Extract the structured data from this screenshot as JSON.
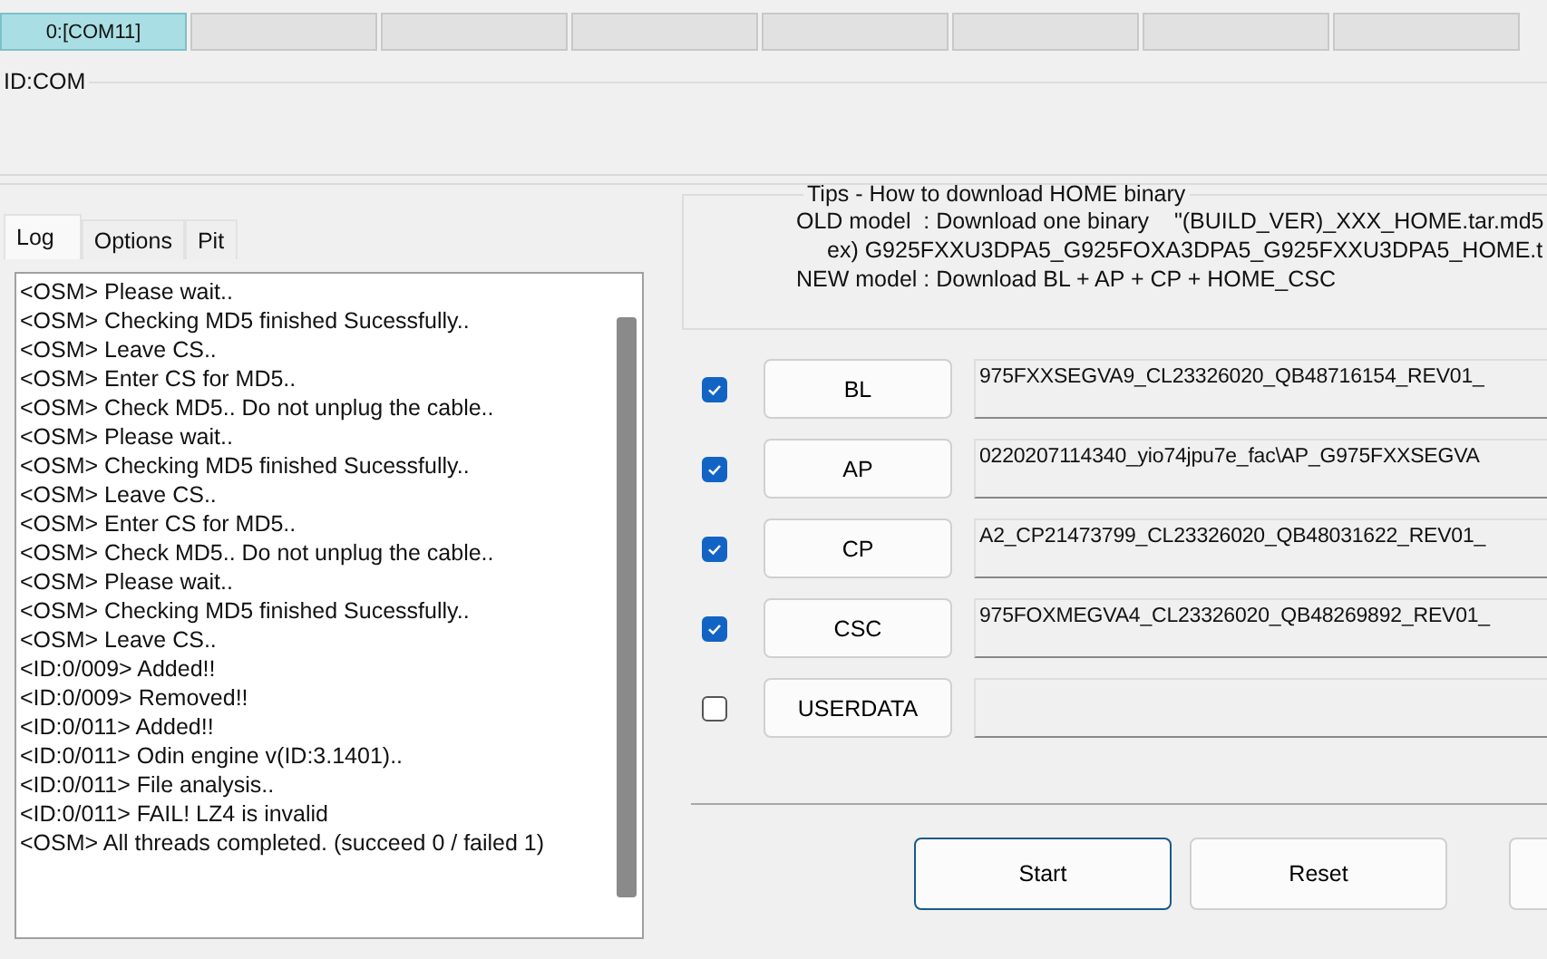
{
  "ports": [
    {
      "label": "0:[COM11]",
      "selected": true
    },
    {
      "selected": false
    },
    {
      "selected": false
    },
    {
      "selected": false
    },
    {
      "selected": false
    },
    {
      "selected": false
    },
    {
      "selected": false
    },
    {
      "selected": false
    }
  ],
  "id_group": {
    "title": "ID:COM"
  },
  "tabs": [
    {
      "label": "Log",
      "selected": true
    },
    {
      "label": "Options",
      "selected": false
    },
    {
      "label": "Pit",
      "selected": false
    }
  ],
  "log": [
    "<OSM> Please wait..",
    "<OSM> Checking MD5 finished Sucessfully..",
    "<OSM> Leave CS..",
    "<OSM> Enter CS for MD5..",
    "<OSM> Check MD5.. Do not unplug the cable..",
    "<OSM> Please wait..",
    "<OSM> Checking MD5 finished Sucessfully..",
    "<OSM> Leave CS..",
    "<OSM> Enter CS for MD5..",
    "<OSM> Check MD5.. Do not unplug the cable..",
    "<OSM> Please wait..",
    "<OSM> Checking MD5 finished Sucessfully..",
    "<OSM> Leave CS..",
    "<ID:0/009> Added!!",
    "<ID:0/009> Removed!!",
    "<ID:0/011> Added!!",
    "<ID:0/011> Odin engine v(ID:3.1401)..",
    "<ID:0/011> File analysis..",
    "<ID:0/011> FAIL! LZ4 is invalid",
    "<OSM> All threads completed. (succeed 0 / failed 1)"
  ],
  "tips": {
    "title": "Tips - How to download HOME binary",
    "lines": [
      "OLD model  : Download one binary    \"(BUILD_VER)_XXX_HOME.tar.md5",
      "ex) G925FXXU3DPA5_G925FOXA3DPA5_G925FXXU3DPA5_HOME.t",
      "NEW model : Download BL + AP + CP + HOME_CSC"
    ]
  },
  "files": [
    {
      "label": "BL",
      "checked": true,
      "path": "975FXXSEGVA9_CL23326020_QB48716154_REV01_"
    },
    {
      "label": "AP",
      "checked": true,
      "path": "0220207114340_yio74jpu7e_fac\\AP_G975FXXSEGVA"
    },
    {
      "label": "CP",
      "checked": true,
      "path": "A2_CP21473799_CL23326020_QB48031622_REV01_"
    },
    {
      "label": "CSC",
      "checked": true,
      "path": "975FOXMEGVA4_CL23326020_QB48269892_REV01_"
    },
    {
      "label": "USERDATA",
      "checked": false
    }
  ],
  "actions": [
    {
      "label": "Start",
      "selected": true
    },
    {
      "label": "Reset",
      "selected": false
    },
    {
      "selected": false
    }
  ]
}
